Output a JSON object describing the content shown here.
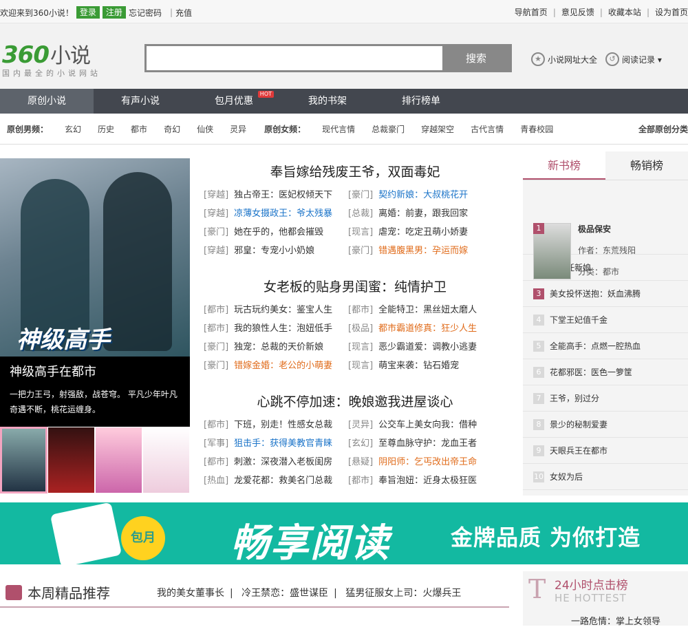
{
  "topbar": {
    "welcome": "欢迎来到360小说！",
    "login": "登录",
    "register": "注册",
    "forgot": "忘记密码",
    "recharge": "充值",
    "links": [
      "导航首页",
      "意见反馈",
      "收藏本站",
      "设为首页"
    ]
  },
  "header": {
    "logo": "360",
    "logo_text": "小说",
    "logo_sub": "国内最全的小说网站",
    "search_button": "搜索",
    "site_links": "小说网址大全",
    "history": "阅读记录 ▾"
  },
  "nav": {
    "items": [
      "原创小说",
      "有声小说",
      "包月优惠",
      "我的书架",
      "排行榜单"
    ],
    "hot": "HOT"
  },
  "cats": {
    "male_head": "原创男频：",
    "male": [
      "玄幻",
      "历史",
      "都市",
      "奇幻",
      "仙侠",
      "灵异"
    ],
    "female_head": "原创女频：",
    "female": [
      "现代言情",
      "总裁豪门",
      "穿越架空",
      "古代言情",
      "青春校园"
    ],
    "all": "全部原创分类"
  },
  "feature": {
    "cover_text": "神级高手",
    "title": "神级高手在都市",
    "desc": "一把力王弓，射强敌，战苍穹。 平凡少年叶凡奇遇不断，桃花运缠身。"
  },
  "sections": [
    {
      "title": "奉旨嫁给残废王爷，双面毒妃",
      "rows": [
        [
          [
            "[穿越]",
            "独占帝王：医妃权倾天下",
            ""
          ],
          [
            "[豪门]",
            "契约新娘：大叔桃花开",
            "blue"
          ]
        ],
        [
          [
            "[穿越]",
            "凉薄女摄政王：爷太残暴",
            "blue"
          ],
          [
            "[总裁]",
            "离婚：前妻，跟我回家",
            ""
          ]
        ],
        [
          [
            "[豪门]",
            "她在乎的，他都会摧毁",
            ""
          ],
          [
            "[现言]",
            "虐宠：吃定丑萌小娇妻",
            ""
          ]
        ],
        [
          [
            "[穿越]",
            "邪皇：专宠小小奶娘",
            ""
          ],
          [
            "[豪门]",
            "错遇腹黑男：孕运而嫁",
            "orange"
          ]
        ]
      ]
    },
    {
      "title": "女老板的贴身男闺蜜：纯情护卫",
      "rows": [
        [
          [
            "[都市]",
            "玩古玩约美女：鉴宝人生",
            ""
          ],
          [
            "[都市]",
            "全能特卫：黑丝妞太磨人",
            ""
          ]
        ],
        [
          [
            "[都市]",
            "我的狼性人生：泡妞低手",
            ""
          ],
          [
            "[极品]",
            "都市霸道修真：狂少人生",
            "orange"
          ]
        ],
        [
          [
            "[豪门]",
            "独宠：总裁的天价新娘",
            ""
          ],
          [
            "[现言]",
            "恶少霸道爱：调教小逃妻",
            ""
          ]
        ],
        [
          [
            "[豪门]",
            "错嫁金婚：老公的小萌妻",
            "orange"
          ],
          [
            "[现言]",
            "萌宝来袭：钻石婚宠",
            ""
          ]
        ]
      ]
    },
    {
      "title": "心跳不停加速：晚娘邀我进屋谈心",
      "rows": [
        [
          [
            "[都市]",
            "下班，别走！性感女总裁",
            ""
          ],
          [
            "[灵异]",
            "公交车上美女向我：借种",
            ""
          ]
        ],
        [
          [
            "[军事]",
            "狙击手：获得美教官青睐",
            "blue"
          ],
          [
            "[玄幻]",
            "至尊血脉守护：龙血王者",
            ""
          ]
        ],
        [
          [
            "[都市]",
            "刺激：深夜潜入老板闺房",
            ""
          ],
          [
            "[悬疑]",
            "阴阳师：乞丐改出帝王命",
            "orange"
          ]
        ],
        [
          [
            "[热血]",
            "龙爱花都：救美名门总裁",
            ""
          ],
          [
            "[都市]",
            "奉旨泡妞：近身太极狂医",
            ""
          ]
        ]
      ]
    }
  ],
  "sidebar": {
    "tabs": [
      "新书榜",
      "畅销榜"
    ],
    "top1": {
      "num": "1",
      "title": "极品保安",
      "author": "作者：东荒残阳",
      "category": "分类：都市"
    },
    "ranks": [
      {
        "num": "2",
        "title": "第七任新娘"
      },
      {
        "num": "3",
        "title": "美女投怀送抱：妖血沸腾"
      },
      {
        "num": "4",
        "title": "下堂王妃值千金"
      },
      {
        "num": "5",
        "title": "全能高手：点燃一腔热血"
      },
      {
        "num": "6",
        "title": "花都邪医：医色一箩筐"
      },
      {
        "num": "7",
        "title": "王爷，别过分"
      },
      {
        "num": "8",
        "title": "景少的秘制爱妻"
      },
      {
        "num": "9",
        "title": "天眼兵王在都市"
      },
      {
        "num": "10",
        "title": "女奴为后"
      }
    ]
  },
  "banner": {
    "badge": "包月",
    "headline": "畅享阅读",
    "slogan": "金牌品质 为你打造"
  },
  "recommend": {
    "title": "本周精品推荐",
    "links": [
      "我的美女董事长",
      "冷王禁恋：盛世谋臣",
      "猛男征服女上司：火爆兵王"
    ]
  },
  "hot24": {
    "letter": "T",
    "title": "24小时点击榜",
    "sub": "HE HOTTEST",
    "first": "一路危情：掌上女领导"
  }
}
